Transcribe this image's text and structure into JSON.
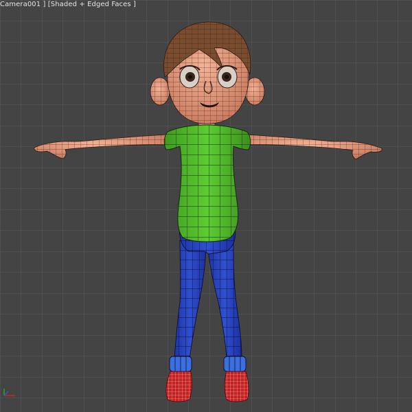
{
  "viewport": {
    "label": "Camera001 ] [Shaded + Edged Faces ]",
    "colors": {
      "background": "#444444",
      "grid": "#595959",
      "skin": "#e69a7d",
      "hair": "#7a4d2f",
      "shirt": "#4fb82a",
      "pants": "#2a45c4",
      "cuffs": "#3b6fe0",
      "shoes": "#c52323",
      "wire": "#1a1a1a"
    }
  },
  "scene": {
    "object": "character-mesh",
    "axis_gizmo": "xyz-axis-gizmo"
  }
}
